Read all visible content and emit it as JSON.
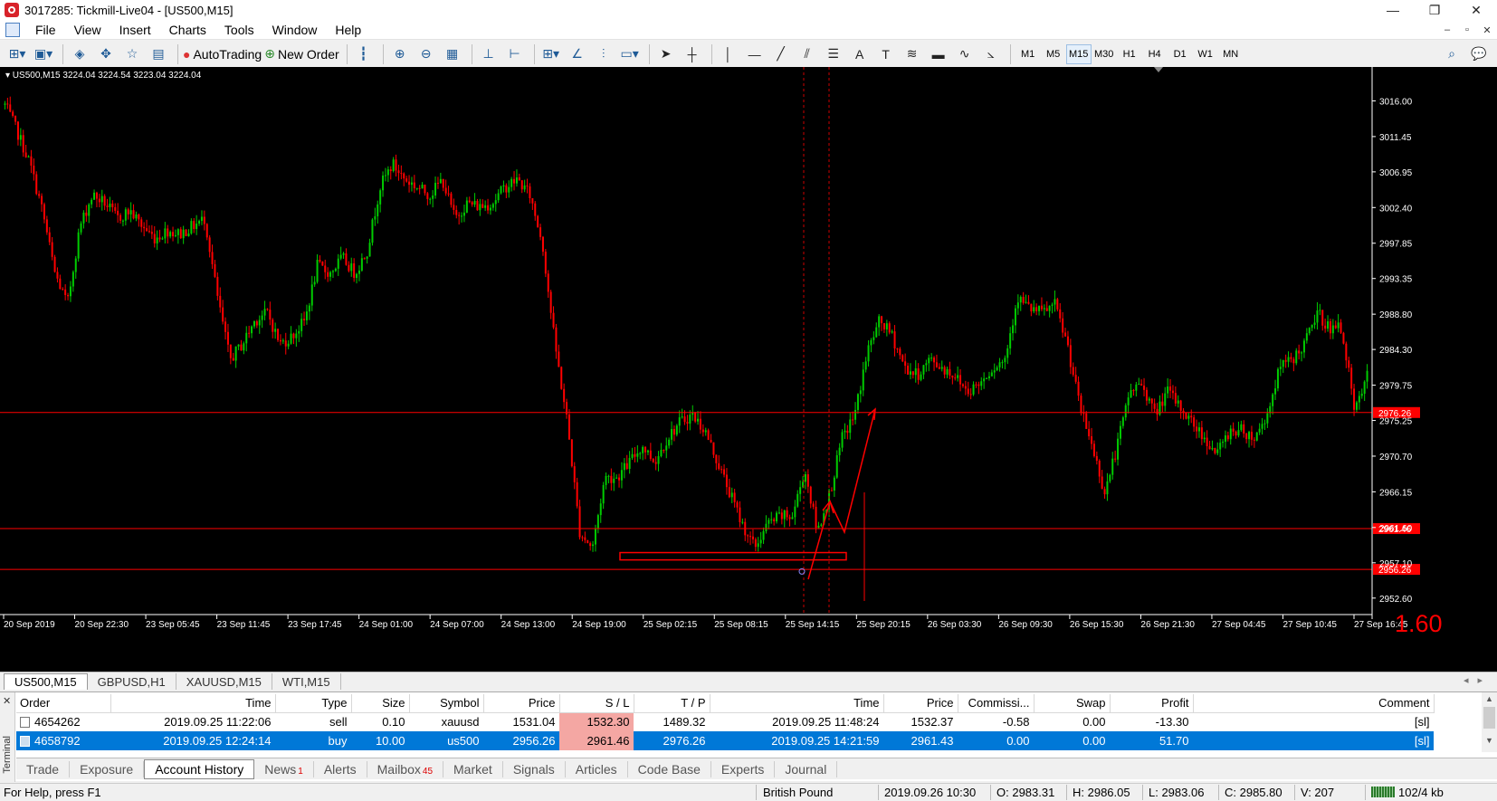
{
  "window": {
    "title": "3017285: Tickmill-Live04 - [US500,M15]",
    "controls": [
      "—",
      "❐",
      "✕"
    ]
  },
  "menu": {
    "items": [
      "File",
      "View",
      "Insert",
      "Charts",
      "Tools",
      "Window",
      "Help"
    ],
    "mdi_controls": [
      "–",
      "▫",
      "✕"
    ]
  },
  "toolbar": {
    "autotrading_label": "AutoTrading",
    "new_order_label": "New Order",
    "timeframes": [
      "M1",
      "M5",
      "M15",
      "M30",
      "H1",
      "H4",
      "D1",
      "W1",
      "MN"
    ],
    "active_timeframe": "M15"
  },
  "chart": {
    "info_line": "▾ US500,M15  3224.04 3224.54 3223.04 3224.04",
    "big_label": "1.60",
    "colors": {
      "background": "#000000",
      "bull": "#00cc00",
      "bear": "#ff0000",
      "axis_text": "#ffffff",
      "level_line": "#ff0000"
    }
  },
  "chart_data": {
    "type": "candlestick",
    "symbol": "US500",
    "timeframe": "M15",
    "y_axis_ticks": [
      3016.0,
      3011.45,
      3006.95,
      3002.4,
      2997.85,
      2993.35,
      2988.8,
      2984.3,
      2979.75,
      2975.25,
      2970.7,
      2966.15,
      2961.6,
      2957.1,
      2952.6
    ],
    "y_axis_labels": [
      "3016.00",
      "3011.45",
      "3006.95",
      "3002.40",
      "2997.85",
      "2993.35",
      "2988.80",
      "2984.30",
      "2979.75",
      "2975.25",
      "2970.70",
      "2966.15",
      "2961.60",
      "2957.10",
      "2952.60"
    ],
    "ylim": [
      2950.5,
      3019.4
    ],
    "x_axis_labels": [
      "20 Sep 2019",
      "20 Sep 22:30",
      "23 Sep 05:45",
      "23 Sep 11:45",
      "23 Sep 17:45",
      "24 Sep 01:00",
      "24 Sep 07:00",
      "24 Sep 13:00",
      "24 Sep 19:00",
      "25 Sep 02:15",
      "25 Sep 08:15",
      "25 Sep 14:15",
      "25 Sep 20:15",
      "26 Sep 03:30",
      "26 Sep 09:30",
      "26 Sep 15:30",
      "26 Sep 21:30",
      "27 Sep 04:45",
      "27 Sep 10:45",
      "27 Sep 16:45"
    ],
    "price_levels": [
      {
        "value": 2976.26,
        "label": "2976.26"
      },
      {
        "value": 2961.46,
        "label": "2961.46"
      },
      {
        "value": 2956.26,
        "label": "2956.26"
      }
    ],
    "close_path": [
      3015.5,
      3012,
      3008,
      3002,
      2994,
      2990,
      3000,
      3004,
      3003,
      3001,
      3002,
      3000,
      2998.5,
      2999.5,
      2999,
      3000,
      3001,
      2991,
      2983,
      2985,
      2988,
      2989,
      2985,
      2986,
      2988,
      2995,
      2994,
      2996,
      2994,
      2997,
      3005,
      3008,
      3006,
      3005,
      3004,
      3006,
      3001,
      3003,
      3002.5,
      3003,
      3005,
      3006,
      3004,
      2998,
      2985,
      2975,
      2961,
      2959,
      2968,
      2968,
      2970,
      2972,
      2970,
      2973,
      2975,
      2976,
      2974,
      2970,
      2966,
      2962,
      2959,
      2962,
      2963,
      2963,
      2969,
      2961,
      2966,
      2973,
      2976,
      2984,
      2988,
      2986,
      2982,
      2981,
      2983,
      2982,
      2981,
      2979,
      2980,
      2982,
      2983,
      2991,
      2989.5,
      2989,
      2990,
      2985,
      2977,
      2972,
      2966,
      2972,
      2979,
      2980,
      2976,
      2979,
      2977,
      2975,
      2973,
      2971,
      2974,
      2974,
      2973,
      2976,
      2982,
      2983,
      2985,
      2989,
      2987,
      2987,
      2976,
      2981
    ]
  },
  "symbol_tabs": [
    "US500,M15",
    "GBPUSD,H1",
    "XAUUSD,M15",
    "WTI,M15"
  ],
  "terminal": {
    "side_label": "Terminal",
    "columns": [
      "Order",
      "Time",
      "Type",
      "Size",
      "Symbol",
      "Price",
      "S / L",
      "T / P",
      "Time",
      "Price",
      "Commissi...",
      "Swap",
      "Profit",
      "Comment"
    ],
    "rows": [
      {
        "order": "4654262",
        "time": "2019.09.25 11:22:06",
        "type": "sell",
        "size": "0.10",
        "symbol": "xauusd",
        "price": "1531.04",
        "sl": "1532.30",
        "tp": "1489.32",
        "close_time": "2019.09.25 11:48:24",
        "close_price": "1532.37",
        "commission": "-0.58",
        "swap": "0.00",
        "profit": "-13.30",
        "comment": "[sl]"
      },
      {
        "order": "4658792",
        "time": "2019.09.25 12:24:14",
        "type": "buy",
        "size": "10.00",
        "symbol": "us500",
        "price": "2956.26",
        "sl": "2961.46",
        "tp": "2976.26",
        "close_time": "2019.09.25 14:21:59",
        "close_price": "2961.43",
        "commission": "0.00",
        "swap": "0.00",
        "profit": "51.70",
        "comment": "[sl]"
      }
    ],
    "tabs": [
      {
        "label": "Trade",
        "badge": ""
      },
      {
        "label": "Exposure",
        "badge": ""
      },
      {
        "label": "Account History",
        "badge": ""
      },
      {
        "label": "News",
        "badge": "1"
      },
      {
        "label": "Alerts",
        "badge": ""
      },
      {
        "label": "Mailbox",
        "badge": "45"
      },
      {
        "label": "Market",
        "badge": ""
      },
      {
        "label": "Signals",
        "badge": ""
      },
      {
        "label": "Articles",
        "badge": ""
      },
      {
        "label": "Code Base",
        "badge": ""
      },
      {
        "label": "Experts",
        "badge": ""
      },
      {
        "label": "Journal",
        "badge": ""
      }
    ],
    "active_tab": "Account History"
  },
  "status": {
    "help": "For Help, press F1",
    "profile": "British Pound",
    "datetime": "2019.09.26 10:30",
    "open": "O: 2983.31",
    "high": "H: 2986.05",
    "low": "L: 2983.06",
    "close": "C: 2985.80",
    "volume": "V: 207",
    "traffic": "102/4 kb"
  }
}
